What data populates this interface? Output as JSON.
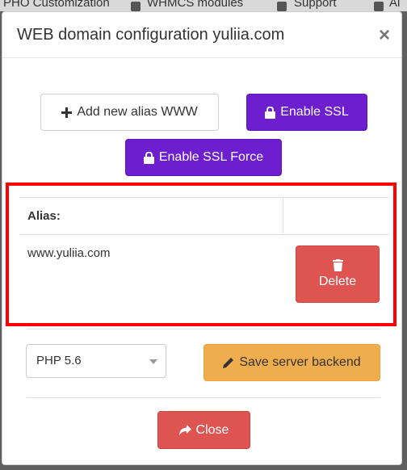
{
  "background_tabs": [
    {
      "label": "PHO Customization"
    },
    {
      "label": "WHMCS modules"
    },
    {
      "label": "Support"
    },
    {
      "label": "Al"
    }
  ],
  "modal": {
    "title": "WEB domain configuration yuliia.com",
    "close_icon": "×"
  },
  "buttons": {
    "add_alias": "Add new alias WWW",
    "enable_ssl": "Enable SSL",
    "enable_ssl_force": "Enable SSL Force",
    "delete": "Delete",
    "save_backend": "Save server backend",
    "close": "Close"
  },
  "alias_table": {
    "header": "Alias:",
    "rows": [
      {
        "alias": "www.yuliia.com"
      }
    ]
  },
  "php_select": {
    "selected": "PHP 5.6"
  },
  "colors": {
    "purple": "#6d1fd0",
    "danger": "#de5451",
    "warning": "#f0ad4e",
    "highlight": "#ff0000"
  },
  "icons": {
    "plus": "plus-icon",
    "lock": "lock-icon",
    "trash": "trash-icon",
    "pencil": "pencil-icon",
    "share": "share-icon"
  }
}
